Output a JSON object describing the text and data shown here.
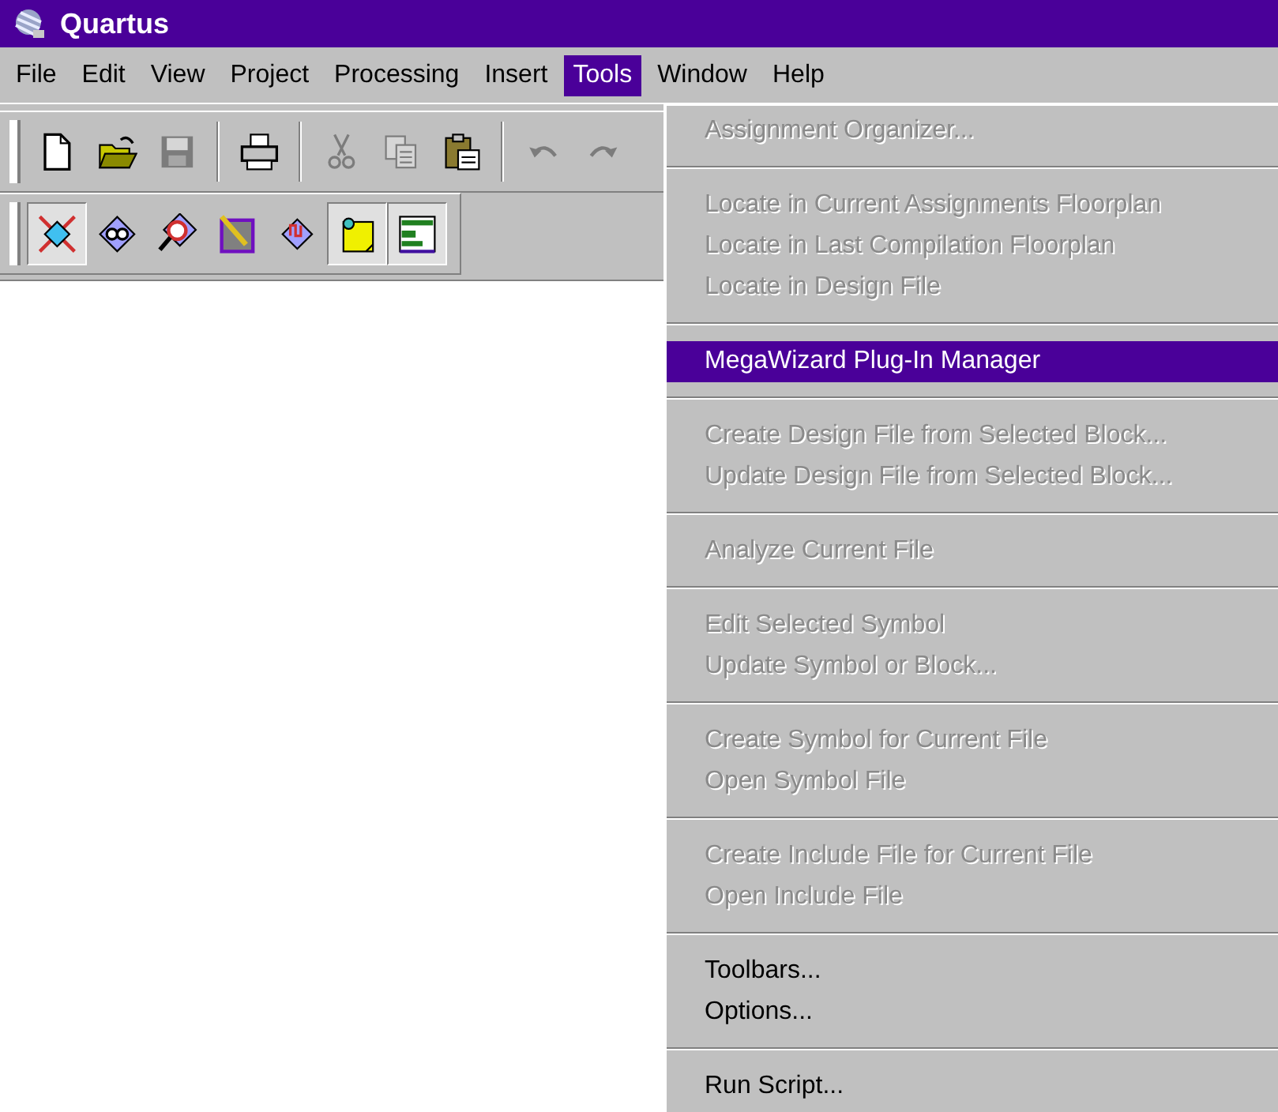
{
  "window": {
    "title": "Quartus"
  },
  "menu_bar": [
    {
      "label": "File",
      "selected": false
    },
    {
      "label": "Edit",
      "selected": false
    },
    {
      "label": "View",
      "selected": false
    },
    {
      "label": "Project",
      "selected": false
    },
    {
      "label": "Processing",
      "selected": false
    },
    {
      "label": "Insert",
      "selected": false
    },
    {
      "label": "Tools",
      "selected": true
    },
    {
      "label": "Window",
      "selected": false
    },
    {
      "label": "Help",
      "selected": false
    }
  ],
  "toolbars": [
    [
      {
        "kind": "new",
        "disabled": false,
        "pressed": false
      },
      {
        "kind": "open",
        "disabled": false,
        "pressed": false
      },
      {
        "kind": "save",
        "disabled": true,
        "pressed": false
      },
      {
        "kind": "separator"
      },
      {
        "kind": "print",
        "disabled": false,
        "pressed": false
      },
      {
        "kind": "separator"
      },
      {
        "kind": "cut",
        "disabled": true,
        "pressed": false
      },
      {
        "kind": "copy",
        "disabled": true,
        "pressed": false
      },
      {
        "kind": "paste",
        "disabled": false,
        "pressed": false
      },
      {
        "kind": "separator"
      },
      {
        "kind": "undo",
        "disabled": true,
        "pressed": false
      },
      {
        "kind": "redo",
        "disabled": true,
        "pressed": false
      }
    ],
    [
      {
        "kind": "chip-cross",
        "disabled": false,
        "pressed": true
      },
      {
        "kind": "chip-binoculars",
        "disabled": false,
        "pressed": false
      },
      {
        "kind": "chip-magnifier",
        "disabled": false,
        "pressed": false
      },
      {
        "kind": "pencil-window",
        "disabled": false,
        "pressed": false
      },
      {
        "kind": "chip-wave",
        "disabled": false,
        "pressed": false
      },
      {
        "kind": "note",
        "disabled": false,
        "pressed": true
      },
      {
        "kind": "table",
        "disabled": false,
        "pressed": true
      }
    ]
  ],
  "tools_menu": [
    [
      {
        "label": "Assignment Organizer...",
        "disabled": true,
        "selected": false
      }
    ],
    [
      {
        "label": "Locate in Current Assignments Floorplan",
        "disabled": true,
        "selected": false
      },
      {
        "label": "Locate in Last Compilation Floorplan",
        "disabled": true,
        "selected": false
      },
      {
        "label": "Locate in Design File",
        "disabled": true,
        "selected": false
      }
    ],
    [
      {
        "label": "MegaWizard Plug-In Manager",
        "disabled": false,
        "selected": true
      }
    ],
    [
      {
        "label": "Create Design File from Selected Block...",
        "disabled": true,
        "selected": false
      },
      {
        "label": "Update Design File from Selected Block...",
        "disabled": true,
        "selected": false
      }
    ],
    [
      {
        "label": "Analyze Current File",
        "disabled": true,
        "selected": false
      }
    ],
    [
      {
        "label": "Edit Selected Symbol",
        "disabled": true,
        "selected": false
      },
      {
        "label": "Update Symbol or Block...",
        "disabled": true,
        "selected": false
      }
    ],
    [
      {
        "label": "Create Symbol for Current File",
        "disabled": true,
        "selected": false
      },
      {
        "label": "Open Symbol File",
        "disabled": true,
        "selected": false
      }
    ],
    [
      {
        "label": "Create Include File for Current File",
        "disabled": true,
        "selected": false
      },
      {
        "label": "Open Include File",
        "disabled": true,
        "selected": false
      }
    ],
    [
      {
        "label": "Toolbars...",
        "disabled": false,
        "selected": false
      },
      {
        "label": "Options...",
        "disabled": false,
        "selected": false
      }
    ],
    [
      {
        "label": "Run Script...",
        "disabled": false,
        "selected": false
      }
    ]
  ]
}
